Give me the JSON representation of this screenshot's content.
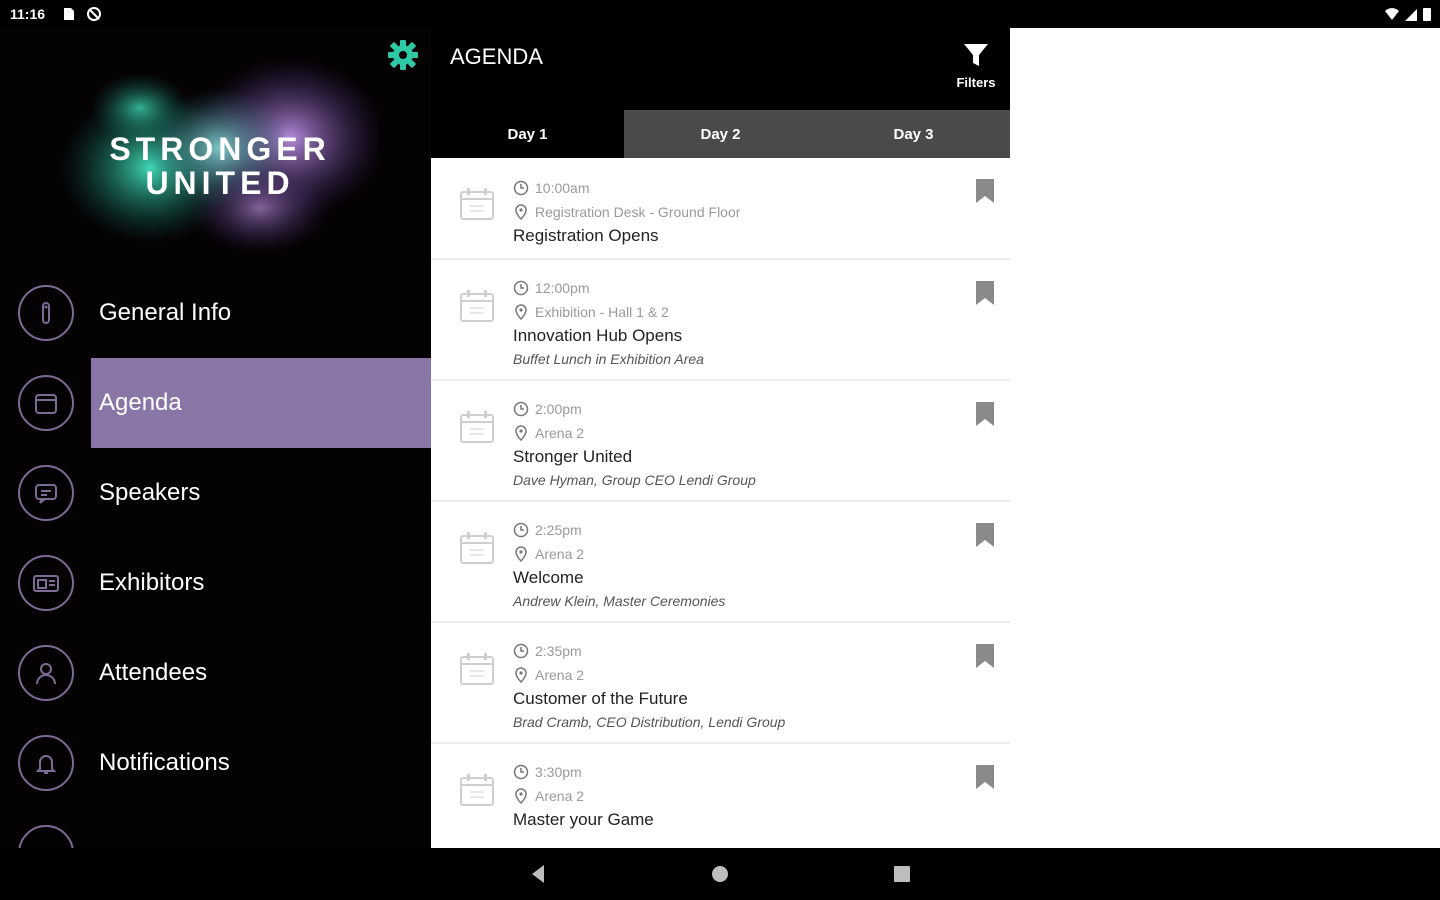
{
  "status_bar": {
    "time": "11:16"
  },
  "logo": {
    "line1": "STRONGER",
    "line2": "UNITED"
  },
  "menu": [
    {
      "label": "General Info",
      "icon": "info-icon",
      "active": false
    },
    {
      "label": "Agenda",
      "icon": "calendar-icon",
      "active": true
    },
    {
      "label": "Speakers",
      "icon": "speech-icon",
      "active": false
    },
    {
      "label": "Exhibitors",
      "icon": "exhibitor-icon",
      "active": false
    },
    {
      "label": "Attendees",
      "icon": "person-icon",
      "active": false
    },
    {
      "label": "Notifications",
      "icon": "bell-icon",
      "active": false
    }
  ],
  "header": {
    "title": "AGENDA",
    "filters_label": "Filters"
  },
  "tabs": [
    {
      "label": "Day 1",
      "active": true
    },
    {
      "label": "Day 2",
      "active": false
    },
    {
      "label": "Day 3",
      "active": false
    }
  ],
  "sessions": [
    {
      "time": "10:00am",
      "location": "Registration Desk - Ground Floor",
      "title": "Registration Opens",
      "subtitle": ""
    },
    {
      "time": "12:00pm",
      "location": "Exhibition - Hall 1 & 2",
      "title": "Innovation Hub Opens",
      "subtitle": "Buffet Lunch in Exhibition Area"
    },
    {
      "time": "2:00pm",
      "location": "Arena 2",
      "title": "Stronger United",
      "subtitle": "Dave Hyman, Group CEO Lendi Group"
    },
    {
      "time": "2:25pm",
      "location": "Arena 2",
      "title": "Welcome",
      "subtitle": "Andrew Klein, Master Ceremonies"
    },
    {
      "time": "2:35pm",
      "location": "Arena 2",
      "title": "Customer of the Future",
      "subtitle": "Brad Cramb, CEO Distribution, Lendi Group"
    },
    {
      "time": "3:30pm",
      "location": "Arena 2",
      "title": "Master your Game",
      "subtitle": ""
    }
  ],
  "colors": {
    "accent": "#8a76a6",
    "gear": "#2fc9a5",
    "tab_inactive": "#4a4a4a"
  }
}
